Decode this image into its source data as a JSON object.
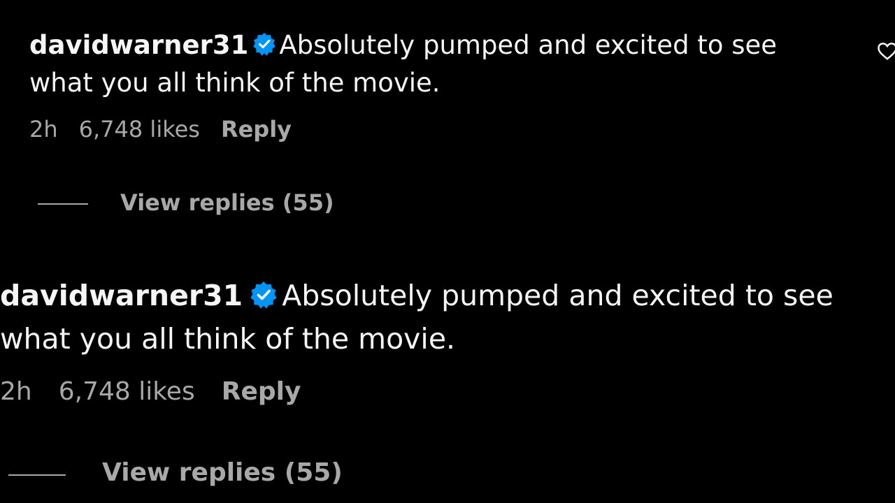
{
  "comments": [
    {
      "username": "davidwarner31",
      "verified_icon": "verified-badge-icon",
      "text": "Absolutely pumped and excited to see what you all think of the movie.",
      "time": "2h",
      "likes": "6,748 likes",
      "reply_label": "Reply",
      "view_replies_label": "View replies (55)"
    },
    {
      "username": "davidwarner31",
      "verified_icon": "verified-badge-icon",
      "text": "Absolutely pumped and excited to see what you all think of the movie.",
      "time": "2h",
      "likes": "6,748 likes",
      "reply_label": "Reply",
      "view_replies_label": "View replies (55)"
    }
  ],
  "colors": {
    "background": "#000000",
    "primary_text": "#f5f5f5",
    "secondary_text": "#a8a8a8",
    "verified_blue": "#0095f6"
  }
}
